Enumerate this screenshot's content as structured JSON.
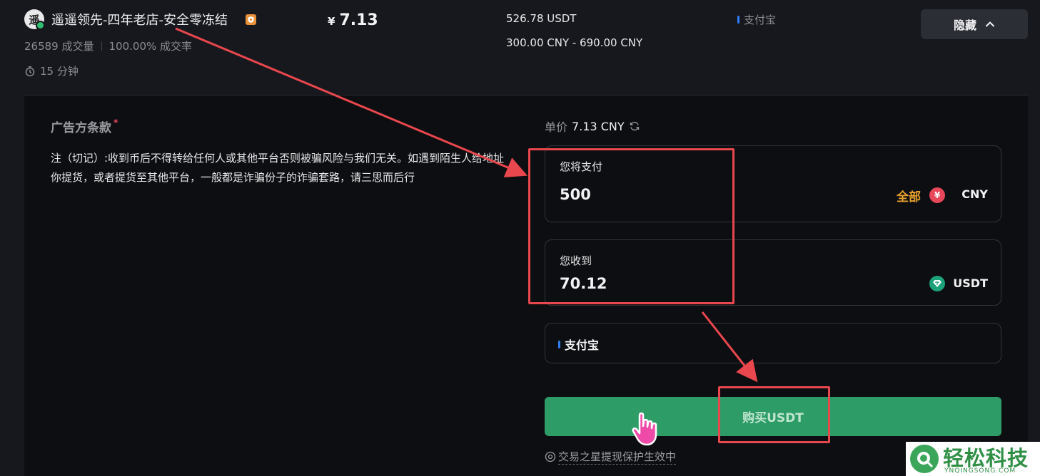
{
  "listing": {
    "avatar_char": "遥",
    "merchant_name": "遥遥领先-四年老店-安全零冻结",
    "trade_count": "26589 成交量",
    "completion_rate": "100.00% 成交率",
    "pay_time": "15 分钟",
    "price_symbol": "¥",
    "price": "7.13",
    "available": "526.78 USDT",
    "limits": "300.00 CNY - 690.00 CNY",
    "payment_method": "支付宝",
    "hide_label": "隐藏"
  },
  "terms": {
    "title": "广告方条款",
    "required_mark": "*",
    "text": "注（切记）:收到币后不得转给任何人或其他平台否则被骗风险与我们无关。如遇到陌生人给地址你提货，或者提货至其他平台，一般都是诈骗份子的诈骗套路，请三思而后行"
  },
  "order": {
    "unit_price_label": "单价",
    "unit_price_value": "7.13 CNY",
    "pay_label": "您将支付",
    "pay_value": "500",
    "all_label": "全部",
    "pay_currency": "CNY",
    "pay_currency_glyph": "¥",
    "receive_label": "您收到",
    "receive_value": "70.12",
    "receive_currency": "USDT",
    "method_label": "支付宝",
    "buy_label": "购买USDT",
    "protection_text": "交易之星提现保护生效中"
  },
  "watermark": {
    "text": "轻松科技",
    "sub": "YNQINGSONG.COM"
  },
  "colors": {
    "buy_button": "#2e9c67",
    "all_link": "#e9a12d",
    "cny_coin": "#e8475a",
    "usdt_coin": "#1ba27a",
    "annotation": "#e8474d"
  }
}
